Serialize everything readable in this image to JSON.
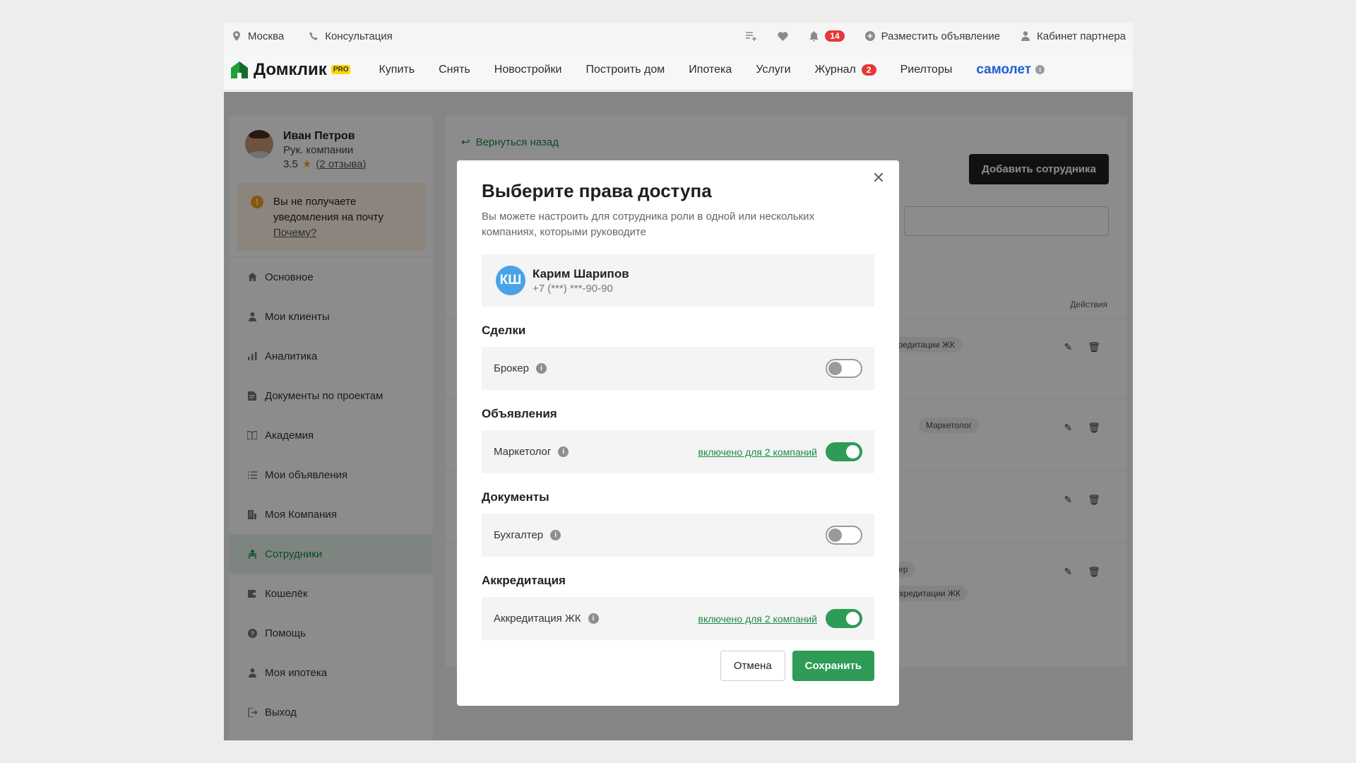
{
  "topbar": {
    "city": "Москва",
    "consult": "Консультация",
    "notif_count": "14",
    "post_ad": "Разместить объявление",
    "partner": "Кабинет партнера"
  },
  "nav": {
    "logo": "Домклик",
    "logo_badge": "PRO",
    "items": [
      "Купить",
      "Снять",
      "Новостройки",
      "Построить дом",
      "Ипотека",
      "Услуги"
    ],
    "journal": "Журнал",
    "journal_count": "2",
    "realtors": "Риелторы",
    "partner_brand": "самолет"
  },
  "profile": {
    "name": "Иван Петров",
    "role": "Рук. компании",
    "rating": "3.5",
    "reviews": "(2 отзыва)"
  },
  "notice": {
    "text": "Вы не получаете уведомления на почту",
    "link": "Почему?"
  },
  "sidebar": {
    "items": [
      {
        "label": "Основное",
        "icon": "home-icon"
      },
      {
        "label": "Мои клиенты",
        "icon": "user-icon"
      },
      {
        "label": "Аналитика",
        "icon": "chart-icon"
      },
      {
        "label": "Документы по проектам",
        "icon": "document-icon"
      },
      {
        "label": "Академия",
        "icon": "academy-icon"
      },
      {
        "label": "Мои объявления",
        "icon": "list-icon"
      },
      {
        "label": "Моя Компания",
        "icon": "company-icon"
      },
      {
        "label": "Сотрудники",
        "icon": "employees-icon",
        "active": true
      },
      {
        "label": "Кошелёк",
        "icon": "wallet-icon"
      },
      {
        "label": "Помощь",
        "icon": "help-icon"
      },
      {
        "label": "Моя ипотека",
        "icon": "user-icon"
      },
      {
        "label": "Выход",
        "icon": "logout-icon"
      }
    ]
  },
  "content": {
    "back": "Вернуться назад",
    "add_employee": "Добавить сотрудника",
    "actions_header": "Действия",
    "chips": [
      "ккредитации ЖК",
      "К",
      "Маркетолог",
      "К",
      "алтер",
      "Аккредитации ЖК"
    ]
  },
  "modal": {
    "title": "Выберите права доступа",
    "subtitle": "Вы можете настроить для сотрудника роли в одной или нескольких компаниях, которыми руководите",
    "user_initials": "КШ",
    "user_name": "Карим Шарипов",
    "user_phone": "+7 (***) ***-90-90",
    "sections": [
      {
        "title": "Сделки",
        "role": "Брокер",
        "enabled": false,
        "enabled_text": ""
      },
      {
        "title": "Объявления",
        "role": "Маркетолог",
        "enabled": true,
        "enabled_text": "включено для 2 компаний"
      },
      {
        "title": "Документы",
        "role": "Бухгалтер",
        "enabled": false,
        "enabled_text": ""
      },
      {
        "title": "Аккредитация",
        "role": "Аккредитация ЖК",
        "enabled": true,
        "enabled_text": "включено для 2 компаний"
      }
    ],
    "cancel": "Отмена",
    "save": "Сохранить"
  },
  "colors": {
    "accent_green": "#2e9b57",
    "badge_red": "#e53935",
    "avatar_blue": "#48a3e8"
  }
}
